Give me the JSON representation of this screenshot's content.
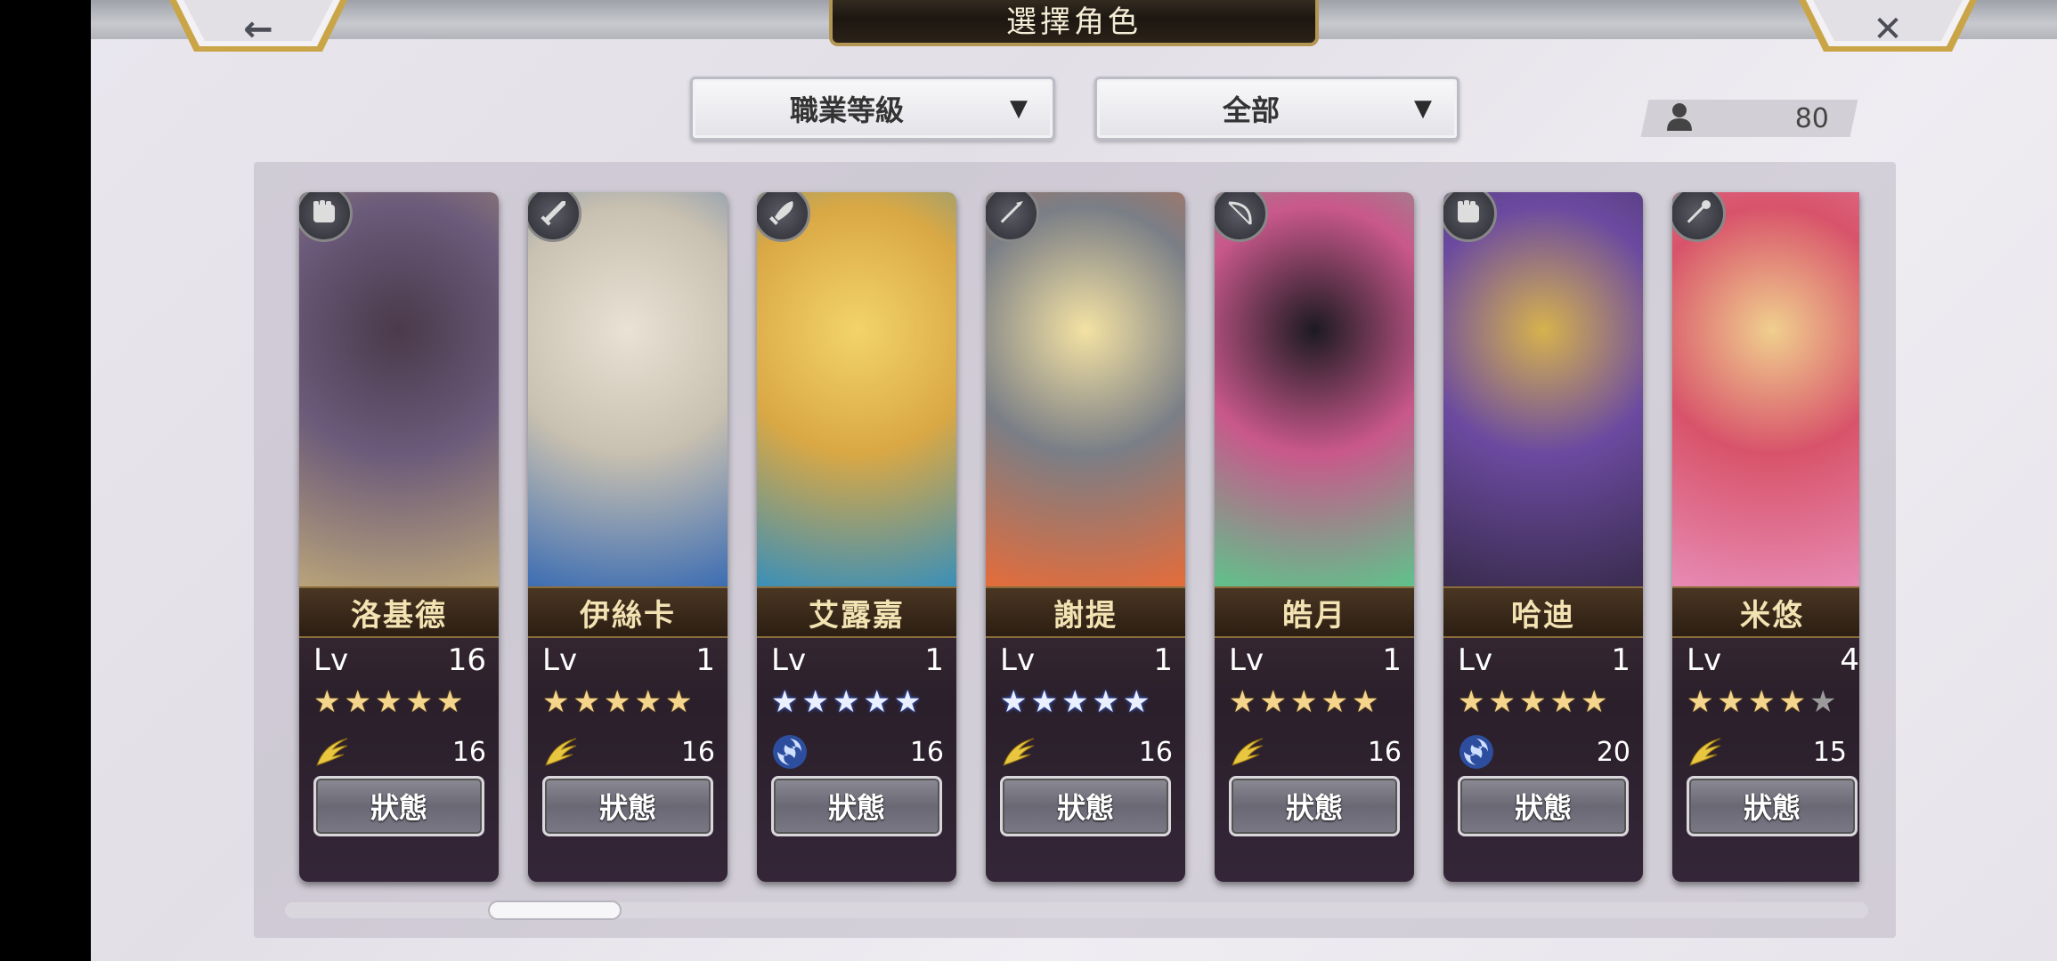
{
  "header": {
    "title": "選擇角色",
    "back_glyph": "←",
    "close_glyph": "✕"
  },
  "filters": {
    "sort_label": "職業等級",
    "filter_label": "全部",
    "arrow": "▼"
  },
  "roster_count": "80",
  "level_prefix": "Lv",
  "status_label": "狀態",
  "colors": {
    "gold_star": "#f5d58c",
    "blue_star": "#eaf0ff",
    "name_text": "#f3e3b3"
  },
  "characters": [
    {
      "name": "洛基德",
      "level": "16",
      "stars": [
        "gold",
        "gold",
        "gold",
        "gold",
        "gold"
      ],
      "attr_icon": "wing-icon",
      "attr_value": "16",
      "class_icon": "fist-icon",
      "portrait": [
        "#4a3a4a",
        "#b9a37a",
        "#6b5a7a"
      ]
    },
    {
      "name": "伊絲卡",
      "level": "1",
      "stars": [
        "gold",
        "gold",
        "gold",
        "gold",
        "gold"
      ],
      "attr_icon": "wing-icon",
      "attr_value": "16",
      "class_icon": "sword-icon",
      "portrait": [
        "#e9e2d5",
        "#3c6db3",
        "#c8c0b0"
      ]
    },
    {
      "name": "艾露嘉",
      "level": "1",
      "stars": [
        "blue",
        "blue",
        "blue",
        "blue",
        "blue"
      ],
      "attr_icon": "swirl-icon",
      "attr_value": "16",
      "class_icon": "blade-icon",
      "portrait": [
        "#f3d36a",
        "#3a8fb8",
        "#d9a845"
      ]
    },
    {
      "name": "謝提",
      "level": "1",
      "stars": [
        "blue",
        "blue",
        "blue",
        "blue",
        "blue"
      ],
      "attr_icon": "wing-icon",
      "attr_value": "16",
      "class_icon": "spear-icon",
      "portrait": [
        "#f4e2a3",
        "#e56c3a",
        "#7a7e86"
      ]
    },
    {
      "name": "皓月",
      "level": "1",
      "stars": [
        "gold",
        "gold",
        "gold",
        "gold",
        "gold"
      ],
      "attr_icon": "wing-icon",
      "attr_value": "16",
      "class_icon": "bow-icon",
      "portrait": [
        "#1c1a22",
        "#5fc28b",
        "#c9588b"
      ]
    },
    {
      "name": "哈迪",
      "level": "1",
      "stars": [
        "gold",
        "gold",
        "gold",
        "gold",
        "gold"
      ],
      "attr_icon": "swirl-icon",
      "attr_value": "20",
      "class_icon": "fist-icon",
      "portrait": [
        "#d6b24e",
        "#3a2c4e",
        "#6b4aa0"
      ]
    },
    {
      "name": "米悠",
      "level": "4",
      "stars": [
        "gold",
        "gold",
        "gold",
        "gold",
        "grey"
      ],
      "attr_icon": "wing-icon",
      "attr_value": "15",
      "class_icon": "staff-icon",
      "portrait": [
        "#f0cf8e",
        "#e78bb4",
        "#d8536a"
      ]
    }
  ],
  "scroll": {
    "thumb_position": 0.14
  }
}
